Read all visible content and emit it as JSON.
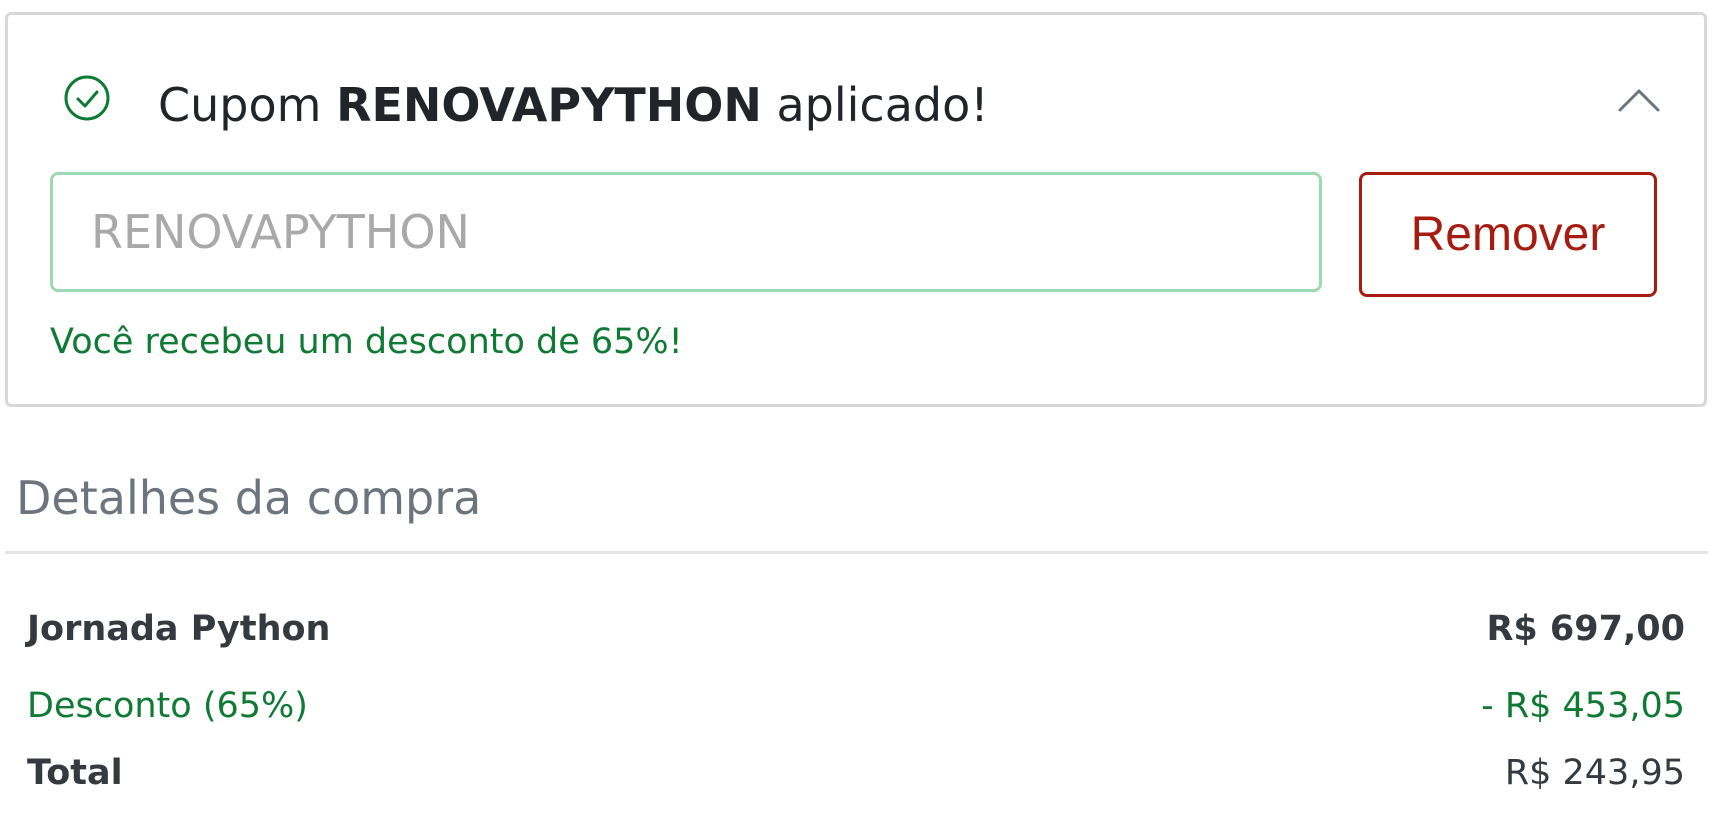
{
  "coupon": {
    "title_prefix": "Cupom",
    "code": "RENOVAPYTHON",
    "title_suffix": "aplicado!",
    "input_placeholder": "RENOVAPYTHON",
    "remove_label": "Remover",
    "message": "Você recebeu um desconto de 65%!",
    "status_icon": "check-circle-icon",
    "toggle_icon": "chevron-up-icon"
  },
  "details": {
    "title": "Detalhes da compra",
    "product": {
      "label": "Jornada Python",
      "value": "R$ 697,00"
    },
    "discount": {
      "label": "Desconto (65%)",
      "value": "- R$ 453,05"
    },
    "total": {
      "label": "Total",
      "value": "R$ 243,95"
    }
  },
  "colors": {
    "success": "#0f7a33",
    "danger": "#a61c10",
    "input_border": "#9fd9b4",
    "muted": "#6c757d"
  }
}
